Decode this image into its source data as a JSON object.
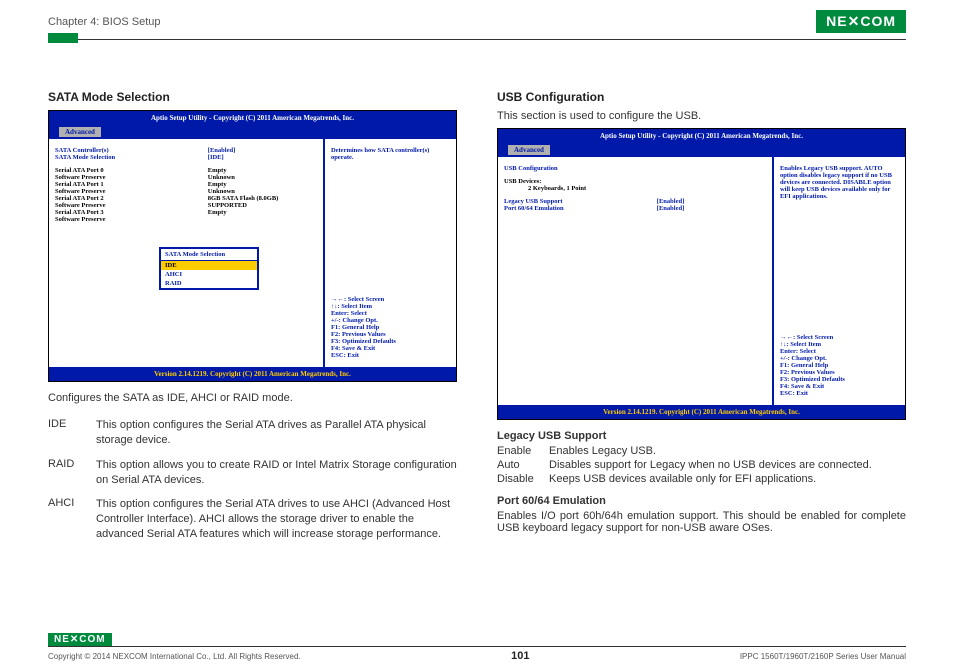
{
  "header": {
    "chapter": "Chapter 4: BIOS Setup",
    "logo": "NE✕COM"
  },
  "left": {
    "heading": "SATA Mode Selection",
    "bios": {
      "title": "Aptio Setup Utility - Copyright (C) 2011 American Megatrends, Inc.",
      "tab": "Advanced",
      "rows_blue": [
        {
          "label": "SATA Controller(s)",
          "value": "[Enabled]"
        },
        {
          "label": "SATA Mode Selection",
          "value": "[IDE]"
        }
      ],
      "rows_black": [
        {
          "label": "Serial ATA Port 0",
          "value": "Empty"
        },
        {
          "label": "    Software Preserve",
          "value": "Unknown"
        },
        {
          "label": "Serial ATA Port 1",
          "value": "Empty"
        },
        {
          "label": "    Software Preserve",
          "value": "Unknown"
        },
        {
          "label": "Serial ATA Port 2",
          "value": "8GB SATA Flash (8.0GB)"
        },
        {
          "label": "    Software Preserve",
          "value": "SUPPORTED"
        },
        {
          "label": "Serial ATA Port 3",
          "value": "Empty"
        },
        {
          "label": "    Software Preserve",
          "value": ""
        }
      ],
      "popup": {
        "title": "SATA Mode Selection",
        "items": [
          "IDE",
          "AHCI",
          "RAID"
        ],
        "selected": 0
      },
      "help_top": "Determines how SATA controller(s) operate.",
      "help_keys": "→←: Select Screen\n↑↓: Select Item\nEnter: Select\n+/-: Change Opt.\nF1: General Help\nF2: Previous Values\nF3: Optimized Defaults\nF4: Save & Exit\nESC: Exit",
      "footer": "Version 2.14.1219. Copyright (C) 2011 American Megatrends, Inc."
    },
    "caption": "Configures the SATA as IDE, AHCI or RAID mode.",
    "defs": [
      {
        "term": "IDE",
        "text": "This option configures the Serial ATA drives as Parallel ATA physical  storage device."
      },
      {
        "term": "RAID",
        "text": "This option allows you to create RAID or Intel Matrix Storage configuration on Serial ATA devices."
      },
      {
        "term": "AHCI",
        "text": "This option configures the Serial ATA drives to use AHCI (Advanced Host Controller Interface). AHCI allows the storage driver to enable the advanced Serial ATA features which will increase storage performance."
      }
    ]
  },
  "right": {
    "heading": "USB Configuration",
    "intro": "This section is used to configure the USB.",
    "bios": {
      "title": "Aptio Setup Utility - Copyright (C) 2011 American Megatrends, Inc.",
      "tab": "Advanced",
      "section_label": "USB Configuration",
      "devices_label": "USB Devices:",
      "devices_value": "2 Keyboards, 1 Point",
      "rows_blue": [
        {
          "label": "Legacy USB Support",
          "value": "[Enabled]"
        },
        {
          "label": "Port 60/64 Emulation",
          "value": "[Enabled]"
        }
      ],
      "help_top": "Enables Legacy USB support. AUTO option disables legacy support if no USB devices are connected. DISABLE option will keep USB devices available only for EFI applications.",
      "help_keys": "→←: Select Screen\n↑↓: Select Item\nEnter: Select\n+/-: Change Opt.\nF1: General Help\nF2: Previous Values\nF3: Optimized Defaults\nF4: Save & Exit\nESC: Exit",
      "footer": "Version 2.14.1219. Copyright (C) 2011 American Megatrends, Inc."
    },
    "sub1": {
      "heading": "Legacy USB Support",
      "rows": [
        {
          "term": "Enable",
          "text": "Enables Legacy USB."
        },
        {
          "term": "Auto",
          "text": "Disables support for Legacy when no USB devices are connected."
        },
        {
          "term": "Disable",
          "text": "Keeps USB devices available only for EFI applications."
        }
      ]
    },
    "sub2": {
      "heading": "Port 60/64 Emulation",
      "text": "Enables I/O port 60h/64h emulation support. This should be enabled for complete USB keyboard legacy support for non-USB aware OSes."
    }
  },
  "footer": {
    "logo": "NE✕COM",
    "copyright": "Copyright © 2014 NEXCOM International Co., Ltd. All Rights Reserved.",
    "page": "101",
    "manual": "IPPC 1560T/1960T/2160P Series User Manual"
  }
}
